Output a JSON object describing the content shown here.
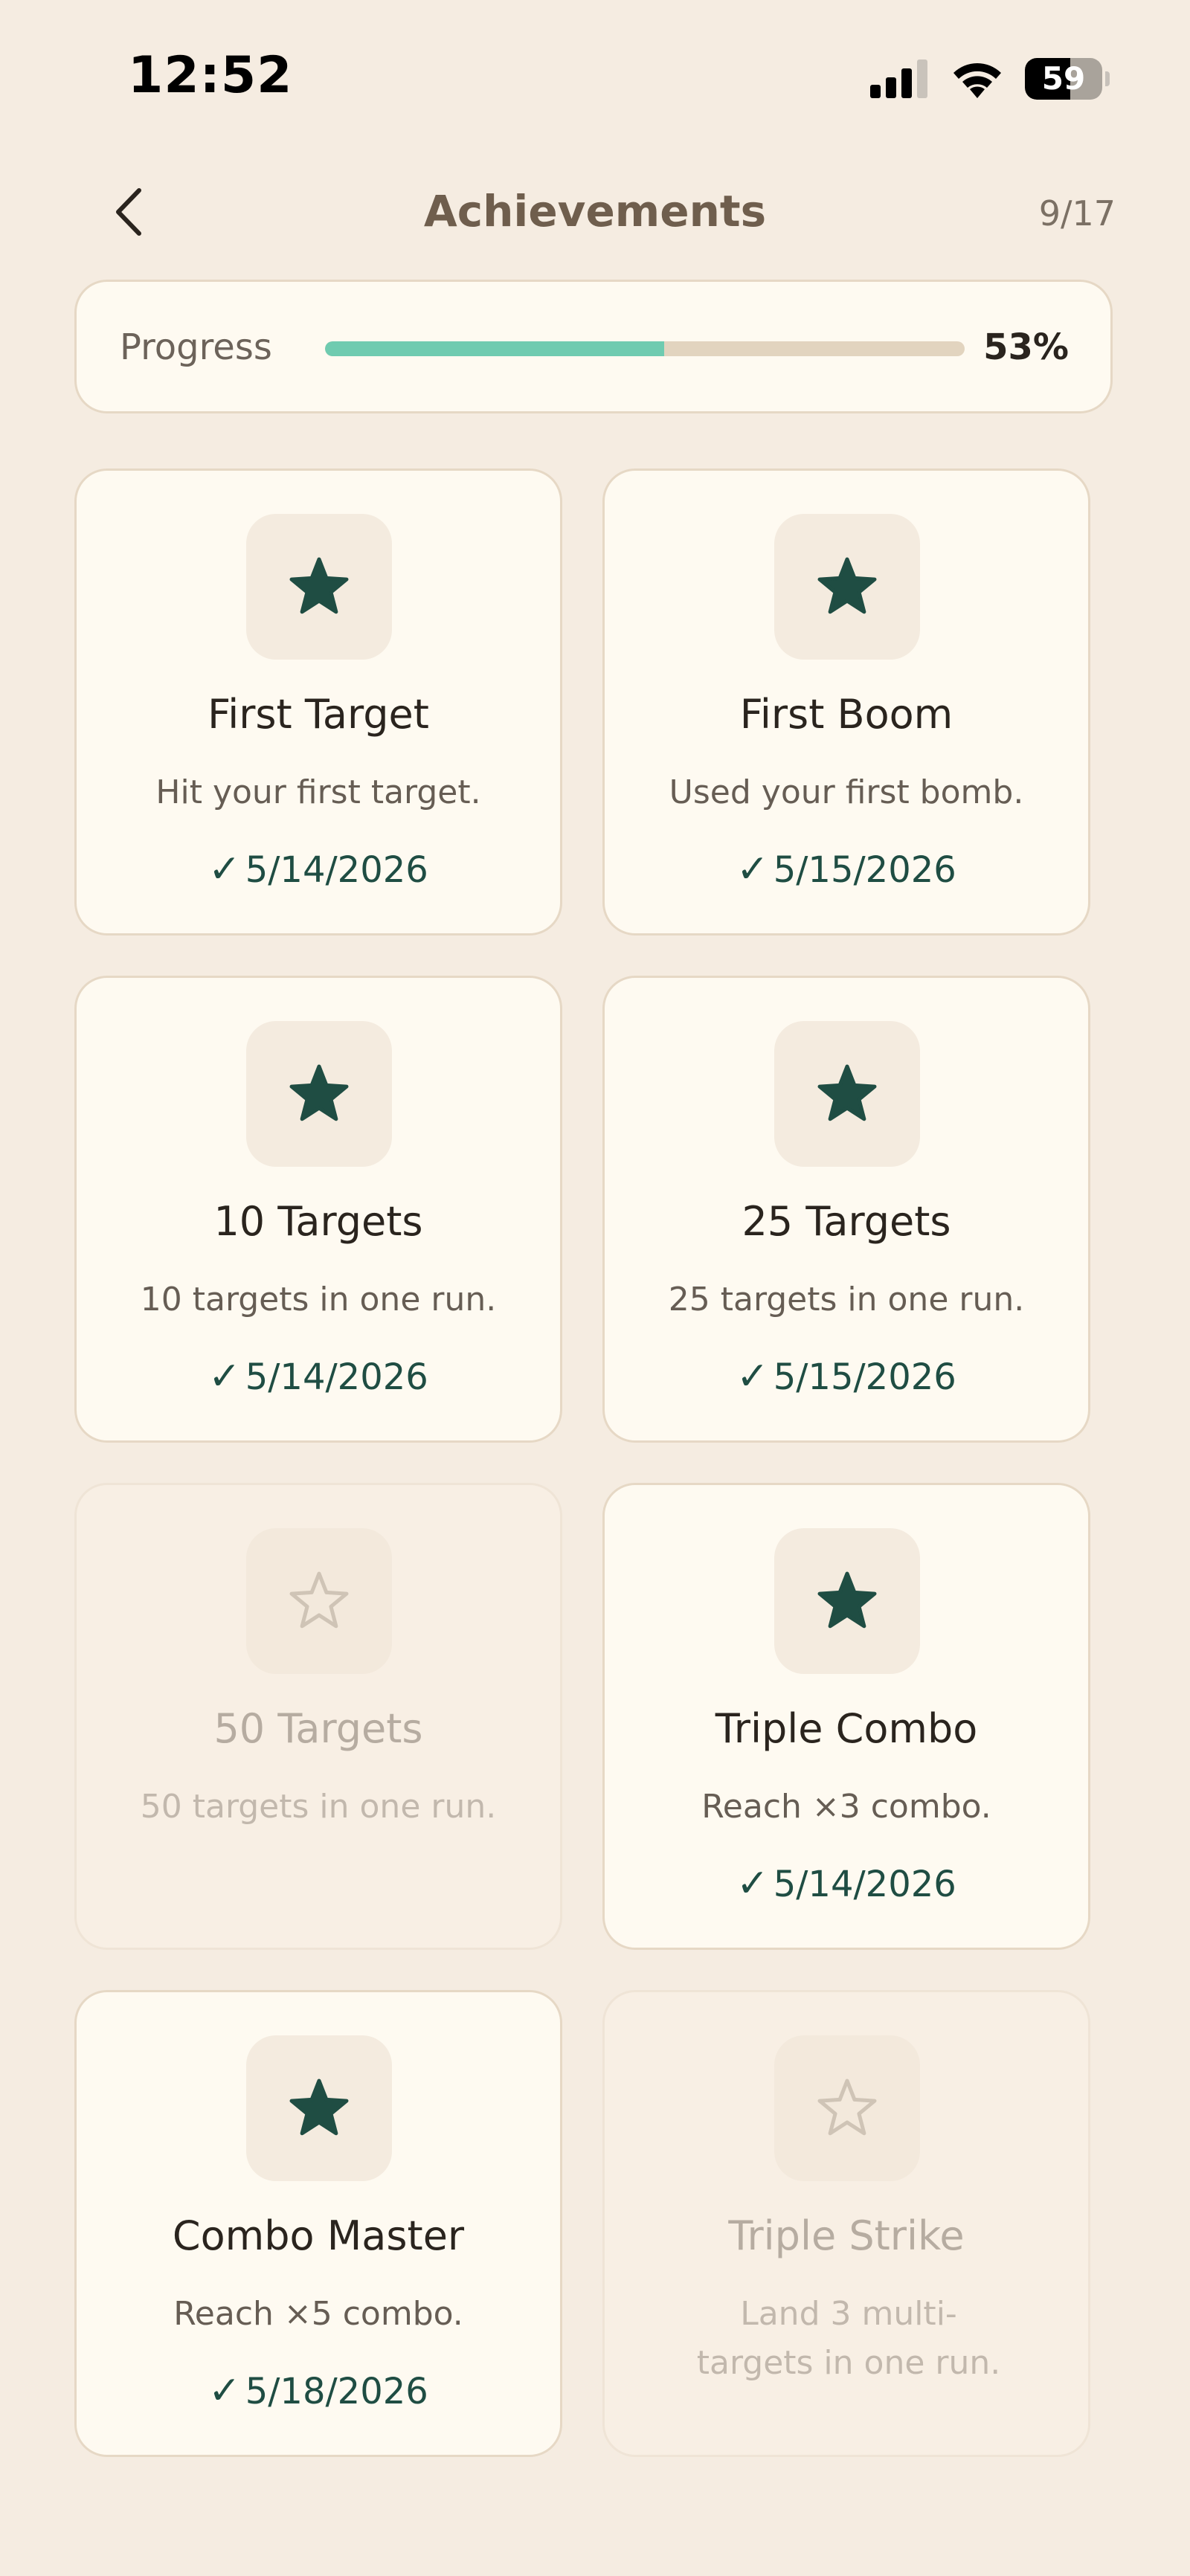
{
  "status_bar": {
    "time": "12:52",
    "battery_level": "59",
    "battery_fraction": 0.59
  },
  "header": {
    "title": "Achievements",
    "count": "9/17",
    "back_icon": "chevron-left-icon"
  },
  "progress": {
    "label": "Progress",
    "percent_text": "53%",
    "fraction": 0.53,
    "fill_color": "#6fcbb0",
    "track_color": "#e2d4bf"
  },
  "colors": {
    "background": "#f5ece1",
    "card": "#fefaf1",
    "card_locked": "#f8efe4",
    "star_unlocked": "#1f4d43",
    "star_locked": "#cfc4b6",
    "title": "#6f5e4d"
  },
  "achievements": [
    {
      "title": "First Target",
      "description": "Hit your first target.",
      "date": "5/14/2026",
      "unlocked": true,
      "icon": "star-filled-icon"
    },
    {
      "title": "First Boom",
      "description": "Used your first bomb.",
      "date": "5/15/2026",
      "unlocked": true,
      "icon": "star-filled-icon"
    },
    {
      "title": "10 Targets",
      "description": "10 targets in one run.",
      "date": "5/14/2026",
      "unlocked": true,
      "icon": "star-filled-icon"
    },
    {
      "title": "25 Targets",
      "description": "25 targets in one run.",
      "date": "5/15/2026",
      "unlocked": true,
      "icon": "star-filled-icon"
    },
    {
      "title": "50 Targets",
      "description": "50 targets in one run.",
      "date": "",
      "unlocked": false,
      "icon": "star-outline-icon"
    },
    {
      "title": "Triple Combo",
      "description": "Reach ×3 combo.",
      "date": "5/14/2026",
      "unlocked": true,
      "icon": "star-filled-icon"
    },
    {
      "title": "Combo Master",
      "description": "Reach ×5 combo.",
      "date": "5/18/2026",
      "unlocked": true,
      "icon": "star-filled-icon"
    },
    {
      "title": "Triple Strike",
      "description": "Land 3 multi-targets in one run.",
      "date": "",
      "unlocked": false,
      "icon": "star-outline-icon"
    }
  ],
  "check_mark": "✓"
}
